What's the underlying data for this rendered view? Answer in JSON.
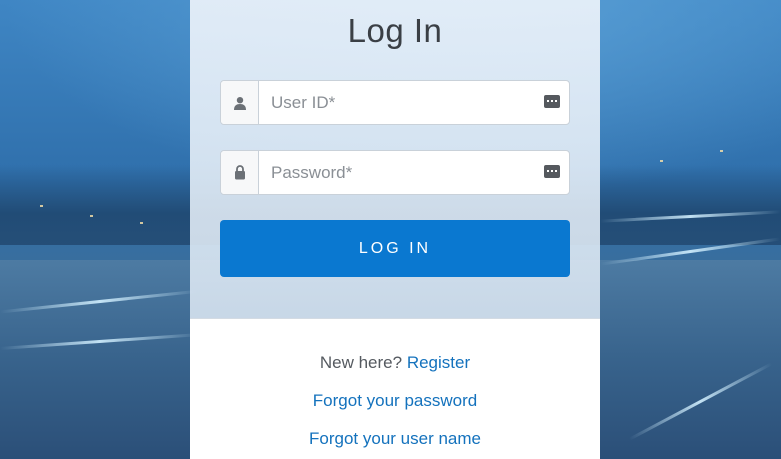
{
  "login": {
    "title": "Log In",
    "user_id": {
      "placeholder": "User ID*",
      "icon": "user-icon"
    },
    "password": {
      "placeholder": "Password*",
      "icon": "lock-icon"
    },
    "submit_label": "LOG IN"
  },
  "footer": {
    "new_here_text": "New here?",
    "register_link": "Register",
    "forgot_password_link": "Forgot your password",
    "forgot_username_link": "Forgot your user name"
  },
  "colors": {
    "accent": "#0a78d0",
    "link": "#1472bd"
  }
}
